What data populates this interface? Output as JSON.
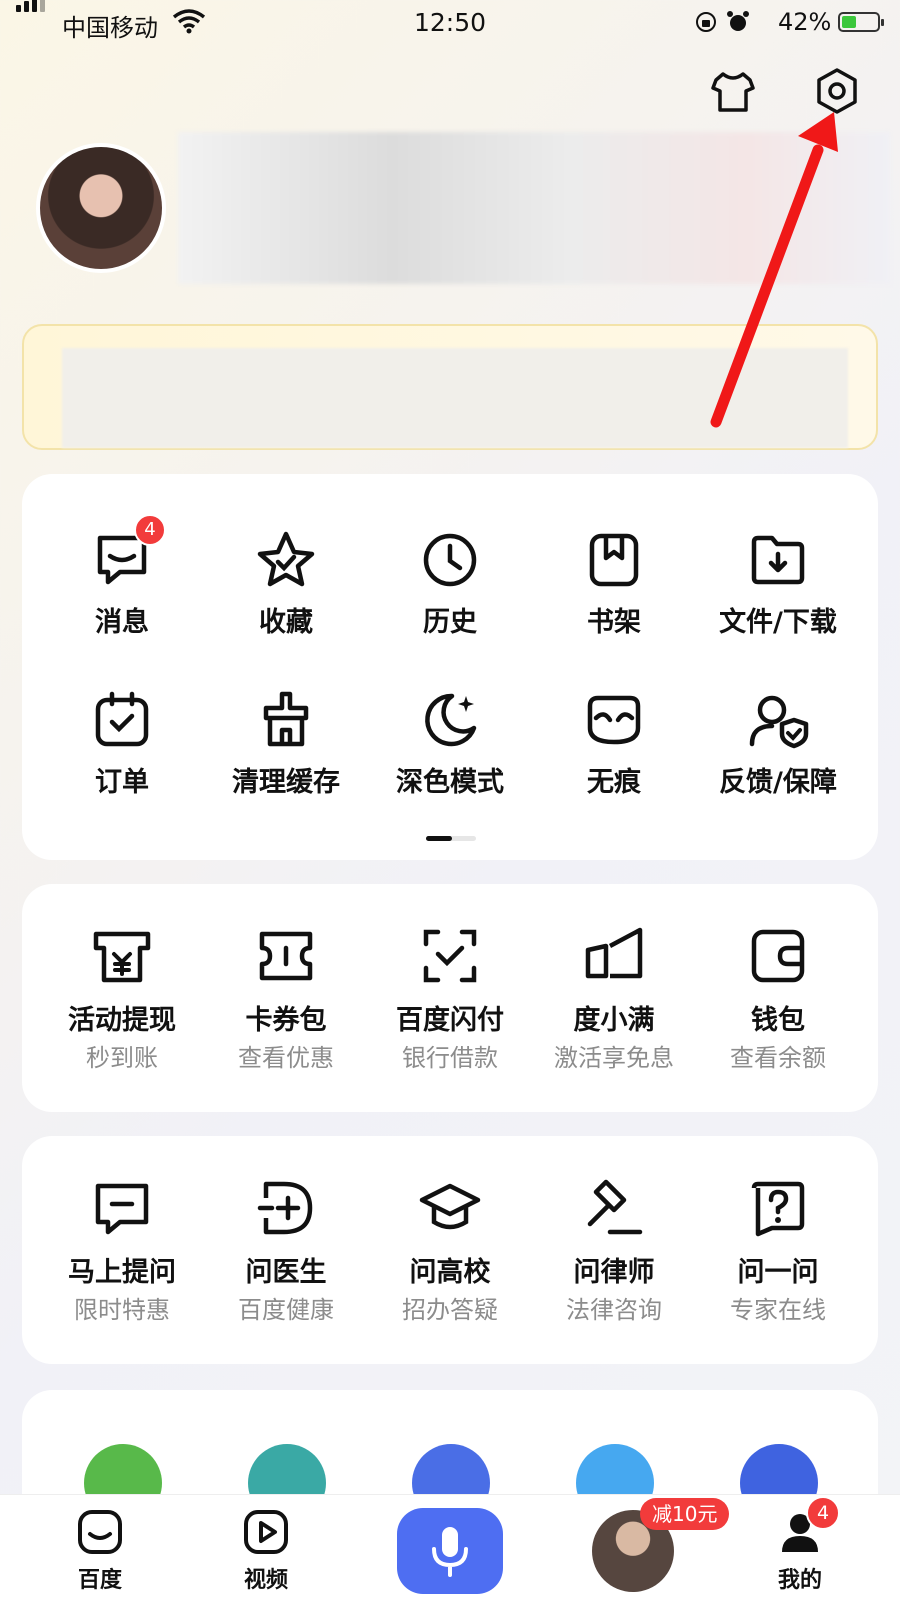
{
  "status_bar": {
    "carrier": "中国移动",
    "time": "12:50",
    "battery": "42%",
    "battery_level": 0.42
  },
  "menu_grid": {
    "items": [
      {
        "label": "消息",
        "icon": "message-icon",
        "badge": "4"
      },
      {
        "label": "收藏",
        "icon": "star-icon"
      },
      {
        "label": "历史",
        "icon": "clock-icon"
      },
      {
        "label": "书架",
        "icon": "bookmark-icon"
      },
      {
        "label": "文件/下载",
        "icon": "download-folder-icon"
      },
      {
        "label": "订单",
        "icon": "order-icon"
      },
      {
        "label": "清理缓存",
        "icon": "cleanup-icon"
      },
      {
        "label": "深色模式",
        "icon": "moon-icon"
      },
      {
        "label": "无痕",
        "icon": "mask-icon"
      },
      {
        "label": "反馈/保障",
        "icon": "feedback-shield-icon"
      }
    ]
  },
  "finance": {
    "items": [
      {
        "label": "活动提现",
        "sub": "秒到账",
        "icon": "cash-withdraw-icon"
      },
      {
        "label": "卡券包",
        "sub": "查看优惠",
        "icon": "coupon-icon"
      },
      {
        "label": "百度闪付",
        "sub": "银行借款",
        "icon": "scan-pay-icon"
      },
      {
        "label": "度小满",
        "sub": "激活享免息",
        "icon": "duxiaoman-icon"
      },
      {
        "label": "钱包",
        "sub": "查看余额",
        "icon": "wallet-icon"
      }
    ]
  },
  "qa": {
    "items": [
      {
        "label": "马上提问",
        "sub": "限时特惠",
        "icon": "ask-bubble-icon"
      },
      {
        "label": "问医生",
        "sub": "百度健康",
        "icon": "doctor-icon"
      },
      {
        "label": "问高校",
        "sub": "招办答疑",
        "icon": "graduation-cap-icon"
      },
      {
        "label": "问律师",
        "sub": "法律咨询",
        "icon": "gavel-icon"
      },
      {
        "label": "问一问",
        "sub": "专家在线",
        "icon": "question-icon"
      }
    ]
  },
  "tab_bar": {
    "tabs": [
      {
        "label": "百度",
        "icon": "baidu-home-icon"
      },
      {
        "label": "视频",
        "icon": "video-play-icon"
      },
      {
        "label": "我的",
        "icon": "profile-icon",
        "badge": "4"
      }
    ],
    "promo_badge": "减10元",
    "mic_icon": "microphone-icon"
  },
  "colors": {
    "accent": "#4e6ef2",
    "badge": "#f23b3b",
    "arrow": "#f01818"
  }
}
